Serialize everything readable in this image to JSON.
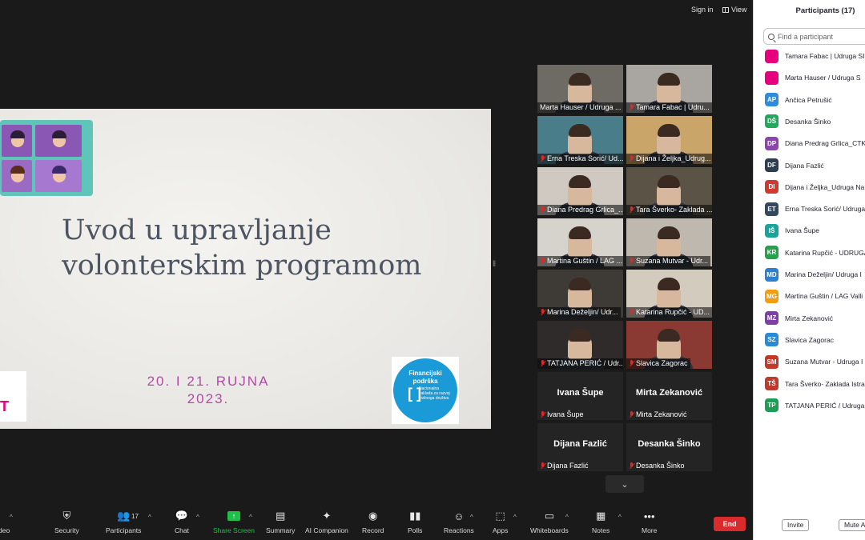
{
  "top_bar": {
    "sign_in": "Sign in",
    "view": "View"
  },
  "slide": {
    "title_line1": "Uvod u upravljanje",
    "title_line2": "volonterskim programom",
    "date_line1": "20. I 21. RUJNA",
    "date_line2": "2023.",
    "left_logo_letter": "T",
    "funding_line1": "Financijski",
    "funding_line2": "podrška",
    "funding_org": "Nacionalna zaklada za razvoj civilnoga društva"
  },
  "video_tiles": [
    {
      "label": "Marta Hauser / Udruga ...",
      "muted": false,
      "active": true,
      "bg": "#6e6a64"
    },
    {
      "label": "Tamara Fabac | Udru...",
      "muted": true,
      "active": false,
      "bg": "#a9a5a0"
    },
    {
      "label": "Erna Treska Sorić/ Ud...",
      "muted": true,
      "active": false,
      "bg": "#4a7d8a"
    },
    {
      "label": "Dijana i Željka_Udrug...",
      "muted": true,
      "active": false,
      "bg": "#c9a56a"
    },
    {
      "label": "Diana Predrag Grlica_...",
      "muted": true,
      "active": false,
      "bg": "#cfc9c2"
    },
    {
      "label": "Tara Šverko- Zaklada ...",
      "muted": true,
      "active": false,
      "bg": "#5b5346"
    },
    {
      "label": "Martina Guštin / LAG ...",
      "muted": true,
      "active": false,
      "bg": "#d6d2cc"
    },
    {
      "label": "Suzana Mutvar - Udr...",
      "muted": true,
      "active": false,
      "bg": "#bfb8ae"
    },
    {
      "label": "Marina Deželjin/ Udr...",
      "muted": true,
      "active": false,
      "bg": "#3e3a36"
    },
    {
      "label": "Katarina Rupčić - UD...",
      "muted": true,
      "active": false,
      "bg": "#d4cbbf"
    },
    {
      "label": "TATJANA PERIĆ / Udr...",
      "muted": true,
      "active": false,
      "bg": "#2e2b2a"
    },
    {
      "label": "Slavica Zagorac",
      "muted": true,
      "active": false,
      "bg": "#8a3a32"
    }
  ],
  "name_tiles": [
    {
      "name": "Ivana Šupe",
      "label": "Ivana Šupe"
    },
    {
      "name": "Mirta Zekanović",
      "label": "Mirta Zekanović"
    },
    {
      "name": "Dijana Fazlić",
      "label": "Dijana Fazlić"
    },
    {
      "name": "Desanka Šinko",
      "label": "Desanka Šinko"
    }
  ],
  "toolbar": {
    "video": "deo",
    "security": "Security",
    "participants": "Participants",
    "participants_count": "17",
    "chat": "Chat",
    "share_screen": "Share Screen",
    "summary": "Summary",
    "ai_companion": "AI Companion",
    "record": "Record",
    "polls": "Polls",
    "reactions": "Reactions",
    "apps": "Apps",
    "whiteboards": "Whiteboards",
    "notes": "Notes",
    "more": "More",
    "end": "End"
  },
  "panel": {
    "title": "Participants (17)",
    "search_placeholder": "Find a participant",
    "invite": "Invite",
    "mute_all": "Mute A",
    "participants": [
      {
        "initials": "",
        "name": "Tamara Fabac | Udruga SI",
        "color": "#e6007e",
        "logo": true
      },
      {
        "initials": "",
        "name": "Marta Hauser / Udruga S",
        "color": "#e6007e",
        "logo": true
      },
      {
        "initials": "AP",
        "name": "Ančica Petrušić",
        "color": "#2d8cdb"
      },
      {
        "initials": "DŠ",
        "name": "Desanka Šinko",
        "color": "#22a85a"
      },
      {
        "initials": "DP",
        "name": "Diana Predrag Grlica_CTK",
        "color": "#8e44ad"
      },
      {
        "initials": "DF",
        "name": "Dijana Fazlić",
        "color": "#2c3e50"
      },
      {
        "initials": "DI",
        "name": "Dijana i Željka_Udruga Na",
        "color": "#d0392f"
      },
      {
        "initials": "ET",
        "name": "Erna Treska Sorić/ Udruga",
        "color": "#34495e"
      },
      {
        "initials": "IŠ",
        "name": "Ivana Šupe",
        "color": "#1aa39a"
      },
      {
        "initials": "KR",
        "name": "Katarina Rupčić - UDRUGA",
        "color": "#27a04a"
      },
      {
        "initials": "MD",
        "name": "Marina Deželjin/ Udruga I",
        "color": "#2d7fd0"
      },
      {
        "initials": "MG",
        "name": "Martina Guštin / LAG Valli",
        "color": "#f39c12"
      },
      {
        "initials": "MZ",
        "name": "Mirta Zekanović",
        "color": "#7d3fa8"
      },
      {
        "initials": "SZ",
        "name": "Slavica Zagorac",
        "color": "#2a8ad3"
      },
      {
        "initials": "SM",
        "name": "Suzana Mutvar - Udruga I",
        "color": "#c0392b"
      },
      {
        "initials": "TŠ",
        "name": "Tara Šverko- Zaklada Istra",
        "color": "#c0392b"
      },
      {
        "initials": "TP",
        "name": "TATJANA PERIĆ / Udruga V",
        "color": "#1f9d55"
      }
    ]
  }
}
